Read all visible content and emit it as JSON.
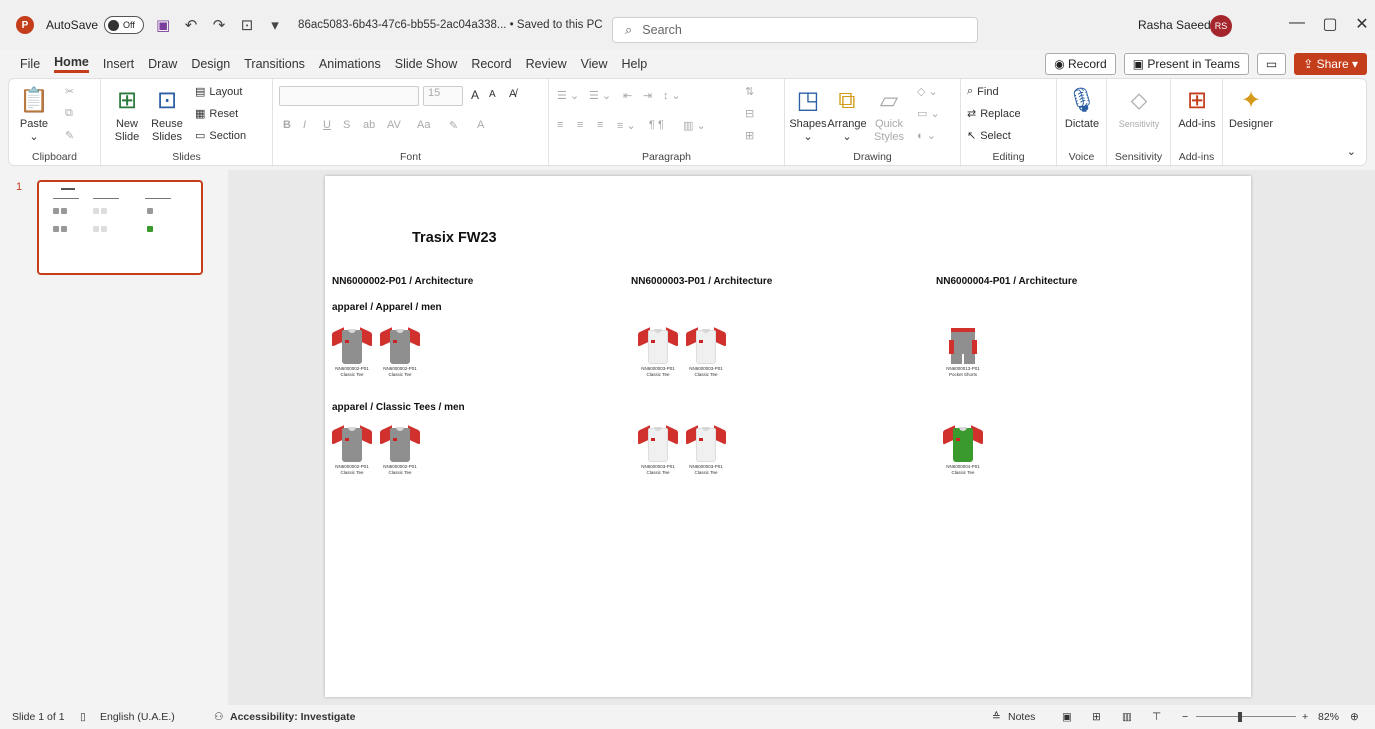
{
  "titlebar": {
    "app_icon_text": "P",
    "autosave_label": "AutoSave",
    "autosave_state": "Off",
    "filename": "86ac5083-6b43-47c6-bb55-2ac04a338...  •  Saved to this PC",
    "search_placeholder": "Search",
    "user_name": "Rasha Saeed",
    "user_initials": "RS"
  },
  "tabs": [
    "File",
    "Home",
    "Insert",
    "Draw",
    "Design",
    "Transitions",
    "Animations",
    "Slide Show",
    "Record",
    "Review",
    "View",
    "Help"
  ],
  "tab_actions": {
    "record": "Record",
    "present": "Present in Teams",
    "share": "Share"
  },
  "ribbon": {
    "clipboard": {
      "paste": "Paste",
      "label": "Clipboard"
    },
    "slides": {
      "new_slide_1": "New",
      "new_slide_2": "Slide",
      "reuse_1": "Reuse",
      "reuse_2": "Slides",
      "layout": "Layout",
      "reset": "Reset",
      "section": "Section",
      "label": "Slides"
    },
    "font": {
      "size": "15",
      "label": "Font"
    },
    "paragraph": {
      "label": "Paragraph"
    },
    "drawing": {
      "shapes": "Shapes",
      "arrange": "Arrange",
      "quick_1": "Quick",
      "quick_2": "Styles",
      "label": "Drawing"
    },
    "editing": {
      "find": "Find",
      "replace": "Replace",
      "select": "Select",
      "label": "Editing"
    },
    "voice": {
      "dictate": "Dictate",
      "label": "Voice"
    },
    "sensitivity": {
      "btn": "Sensitivity",
      "label": "Sensitivity"
    },
    "addins": {
      "btn": "Add-ins",
      "label": "Add-ins"
    },
    "designer": {
      "btn": "Designer"
    }
  },
  "thumbnail": {
    "number": "1"
  },
  "slide": {
    "title": "Trasix FW23",
    "columns": [
      "NN6000002-P01 / Architecture",
      "NN6000003-P01 / Architecture",
      "NN6000004-P01 / Architecture"
    ],
    "sections": [
      "apparel / Apparel / men",
      "apparel / Classic Tees / men"
    ],
    "products": [
      {
        "sku": "NN6000002-P01",
        "name": "Classic Tee"
      },
      {
        "sku": "NN6000002-P01",
        "name": "Classic Tee"
      },
      {
        "sku": "NN6000003-P01",
        "name": "Classic Tee"
      },
      {
        "sku": "NN6000003-P01",
        "name": "Classic Tee"
      },
      {
        "sku": "NN6000013-P01",
        "name": "Pocket Shorts"
      },
      {
        "sku": "NN6000002-P01",
        "name": "Classic Tee"
      },
      {
        "sku": "NN6000002-P01",
        "name": "Classic Tee"
      },
      {
        "sku": "NN6000003-P01",
        "name": "Classic Tee"
      },
      {
        "sku": "NN6000003-P01",
        "name": "Classic Tee"
      },
      {
        "sku": "NN6000004-P01",
        "name": "Classic Tee"
      }
    ]
  },
  "statusbar": {
    "slide_count": "Slide 1 of 1",
    "language": "English (U.A.E.)",
    "accessibility": "Accessibility: Investigate",
    "notes": "Notes",
    "zoom": "82%"
  },
  "colors": {
    "accent": "#c43e1c",
    "tee_gray": "#8f8f8f",
    "tee_white": "#f0f0f0",
    "tee_green": "#3a9a2e",
    "sleeve_red": "#d0312d"
  }
}
